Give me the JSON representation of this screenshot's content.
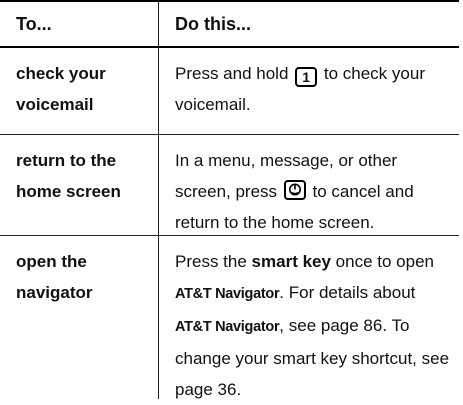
{
  "header": {
    "col1": "To...",
    "col2": "Do this..."
  },
  "rows": [
    {
      "term": "check your voicemail",
      "desc_before": "Press and hold",
      "key": "1",
      "desc_after": "to check your voicemail."
    },
    {
      "term": "return to the home screen",
      "desc_before": "In a menu, message, or other screen, press",
      "key_icon": "end-key-icon",
      "desc_after": "to cancel and return to the home screen."
    },
    {
      "term": "open the navigator",
      "p1": "Press the",
      "smart_key": "smart key",
      "p2": "once to open",
      "brand1": "AT&T Navigator",
      "p3": ". For details about",
      "brand2": "AT&T Navigator",
      "p4": ", see page 86. To change your smart key shortcut, see page 36."
    }
  ]
}
